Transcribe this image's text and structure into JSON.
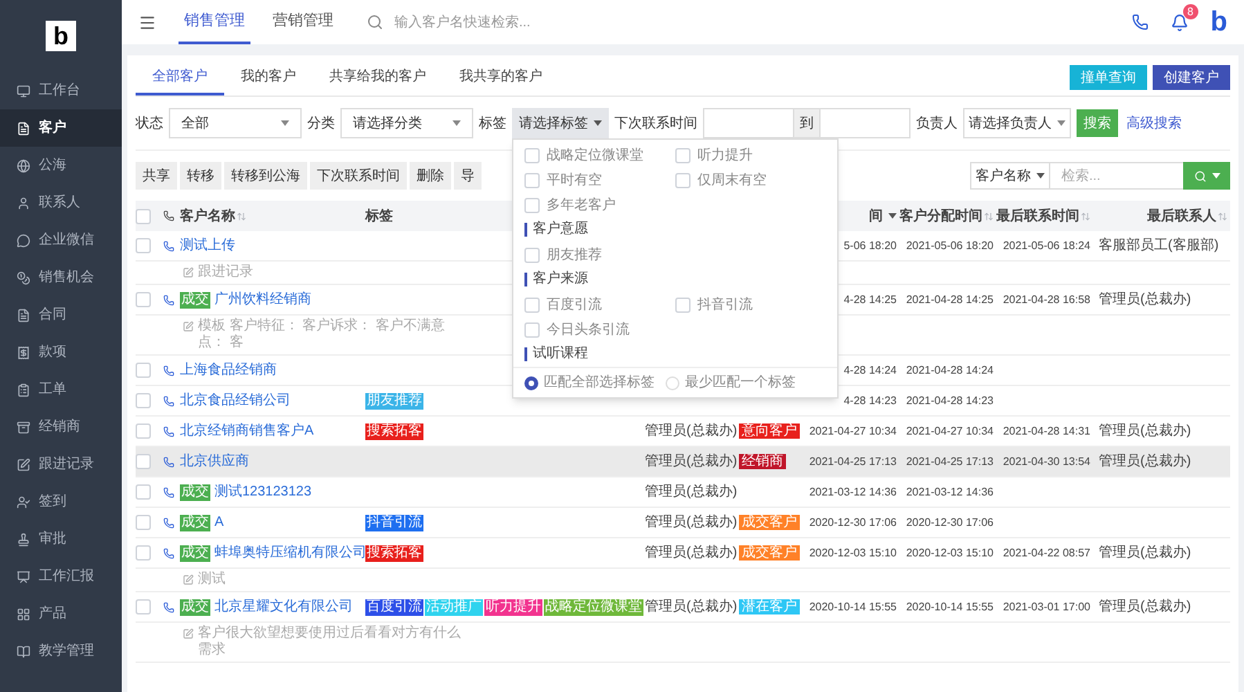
{
  "sidebar": {
    "logo": "b",
    "items": [
      {
        "label": "工作台",
        "selected": false
      },
      {
        "label": "客户",
        "selected": true
      },
      {
        "label": "公海",
        "selected": false
      },
      {
        "label": "联系人",
        "selected": false
      },
      {
        "label": "企业微信",
        "selected": false
      },
      {
        "label": "销售机会",
        "selected": false
      },
      {
        "label": "合同",
        "selected": false
      },
      {
        "label": "款项",
        "selected": false
      },
      {
        "label": "工单",
        "selected": false
      },
      {
        "label": "经销商",
        "selected": false
      },
      {
        "label": "跟进记录",
        "selected": false
      },
      {
        "label": "签到",
        "selected": false
      },
      {
        "label": "审批",
        "selected": false
      },
      {
        "label": "工作汇报",
        "selected": false
      },
      {
        "label": "产品",
        "selected": false
      },
      {
        "label": "教学管理",
        "selected": false
      }
    ]
  },
  "topbar": {
    "tabs": [
      {
        "label": "销售管理",
        "selected": true
      },
      {
        "label": "营销管理",
        "selected": false
      }
    ],
    "search": {
      "placeholder": "输入客户名快速检索..."
    },
    "notification_count": "8",
    "logo": "b"
  },
  "customer_tabs": [
    {
      "label": "全部客户",
      "selected": true
    },
    {
      "label": "我的客户",
      "selected": false
    },
    {
      "label": "共享给我的客户",
      "selected": false
    },
    {
      "label": "我共享的客户",
      "selected": false
    }
  ],
  "header_buttons": [
    {
      "label": "撞单查询",
      "kind": "info"
    },
    {
      "label": "创建客户",
      "kind": "primary"
    }
  ],
  "filters": {
    "status": {
      "label": "状态",
      "value": "全部"
    },
    "category": {
      "label": "分类",
      "value": "请选择分类"
    },
    "tag": {
      "label": "标签",
      "value": "请选择标签",
      "expanded": true
    },
    "next_contact": {
      "label": "下次联系时间",
      "separator": "到"
    },
    "owner": {
      "label": "负责人",
      "value": "请选择负责人"
    },
    "search_button": "搜索",
    "advanced_link": "高级搜索"
  },
  "tag_dropdown": {
    "rows": [
      {
        "kind": "options",
        "options": [
          {
            "label": "战略定位微课堂",
            "checked": false
          },
          {
            "label": "听力提升",
            "checked": false
          }
        ]
      },
      {
        "kind": "options",
        "options": [
          {
            "label": "平时有空",
            "checked": false
          },
          {
            "label": "仅周末有空",
            "checked": false
          }
        ]
      },
      {
        "kind": "options",
        "options": [
          {
            "label": "多年老客户",
            "checked": false
          }
        ]
      },
      {
        "kind": "heading",
        "label": "客户意愿"
      },
      {
        "kind": "options",
        "options": [
          {
            "label": "朋友推荐",
            "checked": false
          }
        ]
      },
      {
        "kind": "heading",
        "label": "客户来源"
      },
      {
        "kind": "options",
        "options": [
          {
            "label": "百度引流",
            "checked": false
          },
          {
            "label": "抖音引流",
            "checked": false
          }
        ]
      },
      {
        "kind": "options",
        "options": [
          {
            "label": "今日头条引流",
            "checked": false
          }
        ]
      },
      {
        "kind": "heading",
        "label": "试听课程"
      }
    ],
    "match_modes": [
      {
        "label": "匹配全部选择标签",
        "selected": true
      },
      {
        "label": "最少匹配一个标签",
        "selected": false
      }
    ]
  },
  "bulk_actions": [
    "共享",
    "转移",
    "转移到公海",
    "下次联系时间",
    "删除",
    "导"
  ],
  "quick_search": {
    "field": "客户名称",
    "placeholder": "检索..."
  },
  "table": {
    "header_checked": false,
    "columns": [
      {
        "label": "客户名称",
        "sortable": true,
        "dropdown": false
      },
      {
        "label": "标签",
        "sortable": false,
        "dropdown": false
      },
      {
        "label": "间",
        "sortable": false,
        "dropdown": true
      },
      {
        "label": "客户分配时间",
        "sortable": true,
        "dropdown": false
      },
      {
        "label": "最后联系时间",
        "sortable": true,
        "dropdown": false
      },
      {
        "label": "最后联系人",
        "sortable": true,
        "dropdown": false
      }
    ],
    "rows": [
      {
        "checked": false,
        "selected": false,
        "name": "测试上传",
        "tags": [],
        "column_5": "5-06 18:20",
        "assigned_at": "2021-05-06 18:20",
        "last_contact_at": "2021-05-06 18:24",
        "last_contact_by": "客服部员工(客服部)",
        "note": "跟进记录"
      },
      {
        "checked": false,
        "selected": false,
        "deal_badge": "成交",
        "name": "广州饮料经销商",
        "tags": [],
        "column_5": "4-28 14:25",
        "assigned_at": "2021-04-28 14:25",
        "last_contact_at": "2021-04-28 16:58",
        "last_contact_by": "管理员(总裁办)",
        "note": "模板 客户特征： 客户诉求： 客户不满意点： 客"
      },
      {
        "checked": false,
        "selected": false,
        "name": "上海食品经销商",
        "tags": [],
        "column_5": "4-28 14:24",
        "assigned_at": "2021-04-28 14:24"
      },
      {
        "checked": false,
        "selected": false,
        "name": "北京食品经销公司",
        "tags": [
          {
            "label": "朋友推荐",
            "color": "#3bb4e8"
          }
        ],
        "column_5": "4-28 14:23",
        "assigned_at": "2021-04-28 14:23"
      },
      {
        "checked": false,
        "selected": false,
        "name": "北京经销商销售客户A",
        "tags": [
          {
            "label": "搜索拓客",
            "color": "#e8201c"
          }
        ],
        "column_3": "管理员(总裁办)",
        "column_4": {
          "label": "意向客户",
          "color": "#e8201c"
        },
        "column_5": "2021-04-27 10:34",
        "assigned_at": "2021-04-27 10:34",
        "last_contact_at": "2021-04-28 14:31",
        "last_contact_by": "管理员(总裁办)"
      },
      {
        "checked": false,
        "selected": true,
        "name": "北京供应商",
        "tags": [],
        "column_3": "管理员(总裁办)",
        "column_4": {
          "label": "经销商",
          "color": "#c0162a"
        },
        "column_5": "2021-04-25 17:13",
        "assigned_at": "2021-04-25 17:13",
        "last_contact_at": "2021-04-30 13:54",
        "last_contact_by": "管理员(总裁办)"
      },
      {
        "checked": false,
        "selected": false,
        "deal_badge": "成交",
        "name": "测试123123123",
        "tags": [],
        "column_3": "管理员(总裁办)",
        "column_5": "2021-03-12 14:36",
        "assigned_at": "2021-03-12 14:36"
      },
      {
        "checked": false,
        "selected": false,
        "deal_badge": "成交",
        "name": "A",
        "tags": [
          {
            "label": "抖音引流",
            "color": "#1e6ff0"
          }
        ],
        "column_3": "管理员(总裁办)",
        "column_4": {
          "label": "成交客户",
          "color": "#ff8128"
        },
        "column_5": "2020-12-30 17:06",
        "assigned_at": "2020-12-30 17:06"
      },
      {
        "checked": false,
        "selected": false,
        "deal_badge": "成交",
        "name": "蚌埠奥特压缩机有限公司",
        "tags": [
          {
            "label": "搜索拓客",
            "color": "#e8201c"
          }
        ],
        "column_3": "管理员(总裁办)",
        "column_4": {
          "label": "成交客户",
          "color": "#ff8128"
        },
        "column_5": "2020-12-03 15:10",
        "assigned_at": "2020-12-03 15:10",
        "last_contact_at": "2021-04-22 08:57",
        "last_contact_by": "管理员(总裁办)",
        "note": "测试"
      },
      {
        "checked": false,
        "selected": false,
        "deal_badge": "成交",
        "name": "北京星耀文化有限公司",
        "tags": [
          {
            "label": "百度引流",
            "color": "#2d4fe8"
          },
          {
            "label": "活动推广",
            "color": "#2fd3ee"
          },
          {
            "label": "听力提升",
            "color": "#f2348f"
          },
          {
            "label": "战略定位微课堂",
            "color": "#6fb83a"
          }
        ],
        "column_3": "管理员(总裁办)",
        "column_4": {
          "label": "潜在客户",
          "color": "#2ec7f5"
        },
        "column_5": "2020-10-14 15:55",
        "assigned_at": "2020-10-14 15:55",
        "last_contact_at": "2021-03-01 17:00",
        "last_contact_by": "管理员(总裁办)",
        "note": "客户很大欲望想要使用过后看看对方有什么需求"
      }
    ]
  }
}
